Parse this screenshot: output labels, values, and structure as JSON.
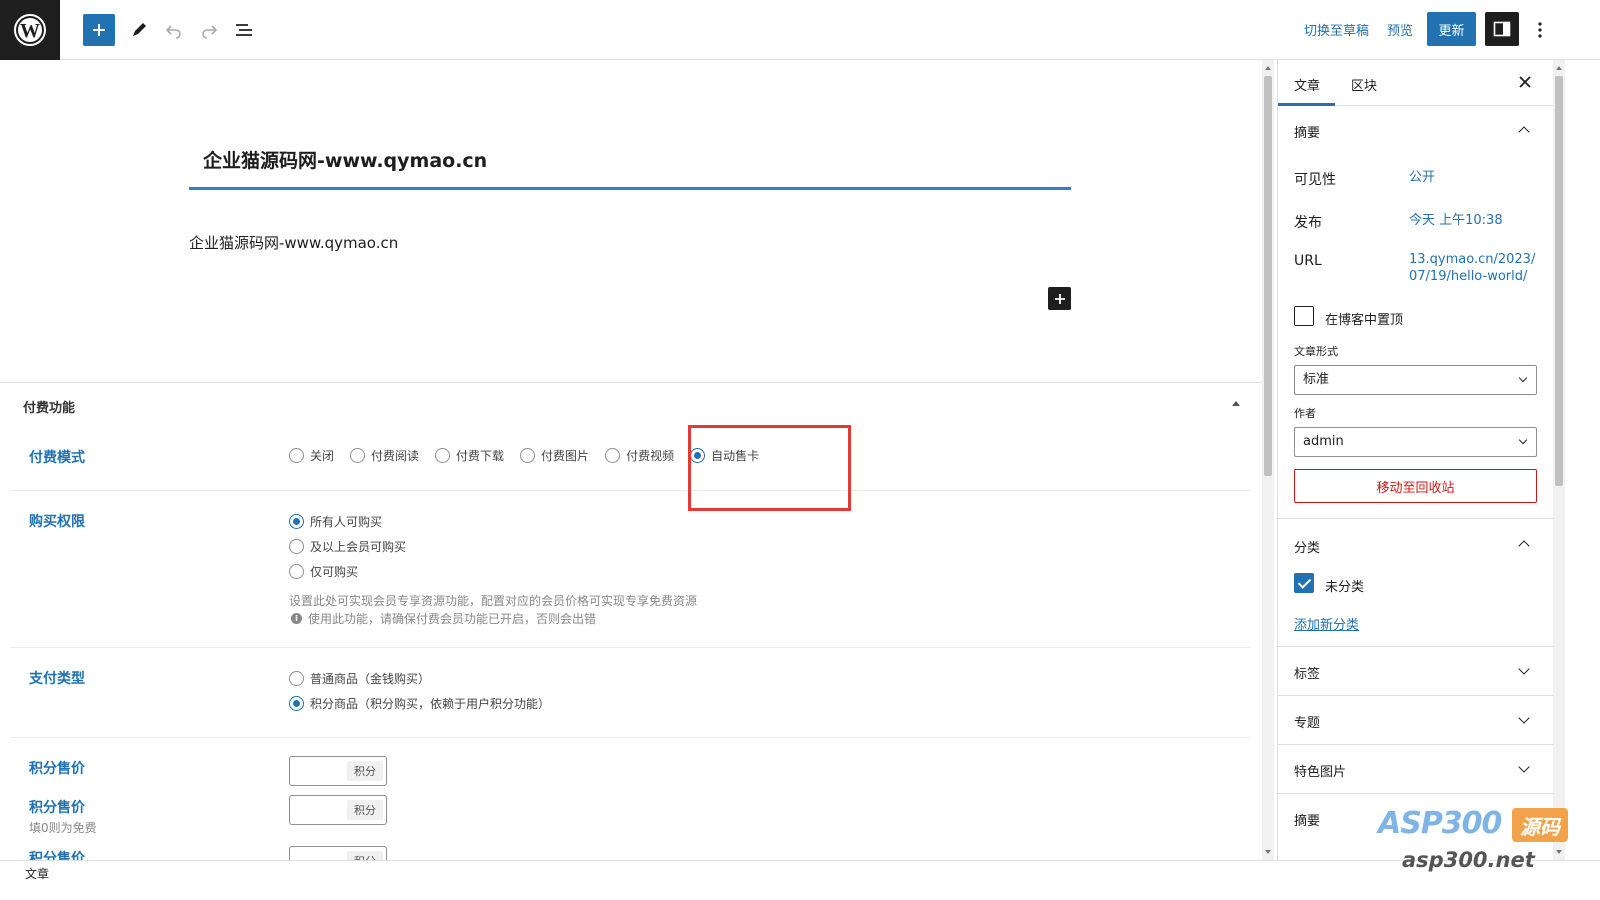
{
  "topbar": {
    "switch_to_draft": "切换至草稿",
    "preview": "预览",
    "update": "更新"
  },
  "post": {
    "title": "企业猫源码网-www.qymao.cn",
    "paragraph": "企业猫源码网-www.qymao.cn"
  },
  "metabox": {
    "title": "付费功能",
    "pay_mode": {
      "label": "付费模式",
      "options": [
        "关闭",
        "付费阅读",
        "付费下载",
        "付费图片",
        "付费视频",
        "自动售卡"
      ],
      "selected": "自动售卡"
    },
    "purchase_permission": {
      "label": "购买权限",
      "options": [
        "所有人可购买",
        "及以上会员可购买",
        "仅可购买"
      ],
      "selected": "所有人可购买",
      "help": "设置此处可实现会员专享资源功能，配置对应的会员价格可实现专享免费资源",
      "info": "使用此功能，请确保付费会员功能已开启，否则会出错"
    },
    "pay_type": {
      "label": "支付类型",
      "options": [
        "普通商品（金钱购买）",
        "积分商品（积分购买，依赖于用户积分功能）"
      ],
      "selected": "积分商品（积分购买，依赖于用户积分功能）"
    },
    "points_price_1": {
      "label": "积分售价",
      "suffix": "积分"
    },
    "points_price_2": {
      "label": "积分售价",
      "sub": "填0则为免费",
      "suffix": "积分"
    },
    "points_price_3": {
      "label": "积分售价",
      "suffix": "积分"
    }
  },
  "status_bar": {
    "text": "文章"
  },
  "sidebar": {
    "tabs": [
      "文章",
      "区块"
    ],
    "active_tab": "文章",
    "summary": {
      "title": "摘要",
      "visibility_label": "可见性",
      "visibility_value": "公开",
      "publish_label": "发布",
      "publish_value": "今天 上午10:38",
      "url_label": "URL",
      "url_line1": "13.qymao.cn/2023/",
      "url_line2": "07/19/hello-world/",
      "sticky_label": "在博客中置顶",
      "format_label": "文章形式",
      "format_value": "标准",
      "author_label": "作者",
      "author_value": "admin",
      "trash_button": "移动至回收站"
    },
    "categories": {
      "title": "分类",
      "items": [
        {
          "label": "未分类",
          "checked": true
        }
      ],
      "add_new": "添加新分类"
    },
    "collapsed_sections": [
      "标签",
      "专题",
      "特色图片",
      "摘要"
    ]
  },
  "watermark": {
    "main": "ASP300",
    "badge": "源码",
    "sub": "asp300.net"
  },
  "colors": {
    "accent": "#2271b1",
    "highlight": "#e53935",
    "danger": "#cc1818",
    "dark": "#1e1e1e"
  }
}
